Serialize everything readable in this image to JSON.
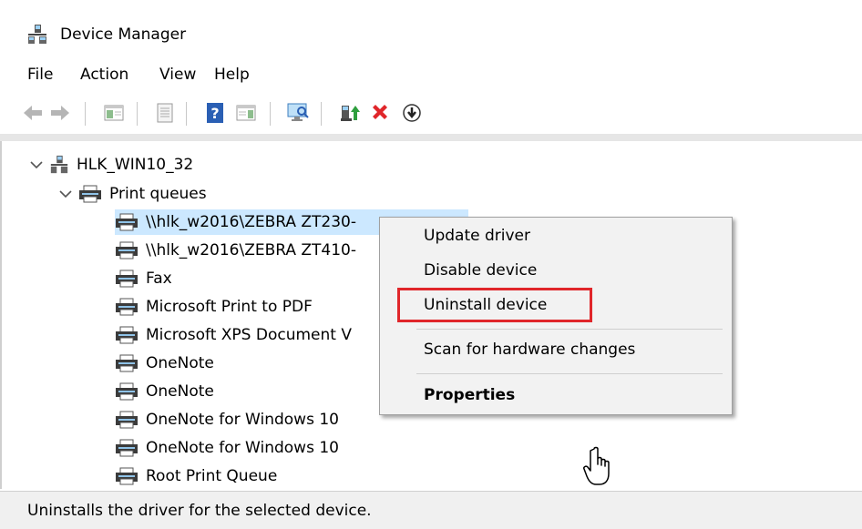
{
  "window": {
    "title": "Device Manager"
  },
  "menubar": {
    "items": [
      "File",
      "Action",
      "View",
      "Help"
    ]
  },
  "toolbar": {
    "buttons": [
      "back-icon",
      "forward-icon",
      "show-hide-console-tree-icon",
      "properties-pane-icon",
      "help-icon",
      "action-pane-icon",
      "scan-hardware-icon",
      "update-driver-icon",
      "uninstall-icon",
      "download-icon"
    ],
    "colors": {
      "green": "#2e9e3e",
      "red": "#e0262a",
      "blue": "#2a5fb4"
    }
  },
  "tree": {
    "root": "HLK_WIN10_32",
    "category": "Print queues",
    "items": [
      "\\\\hlk_w2016\\ZEBRA ZT230-",
      "\\\\hlk_w2016\\ZEBRA ZT410-",
      "Fax",
      "Microsoft Print to PDF",
      "Microsoft XPS Document V",
      "OneNote",
      "OneNote",
      "OneNote for Windows 10",
      "OneNote for Windows 10",
      "Root Print Queue"
    ]
  },
  "context_menu": {
    "items": [
      "Update driver",
      "Disable device",
      "Uninstall device",
      "Scan for hardware changes",
      "Properties"
    ],
    "highlighted": "Uninstall device"
  },
  "status": {
    "text": "Uninstalls the driver for the selected device."
  }
}
